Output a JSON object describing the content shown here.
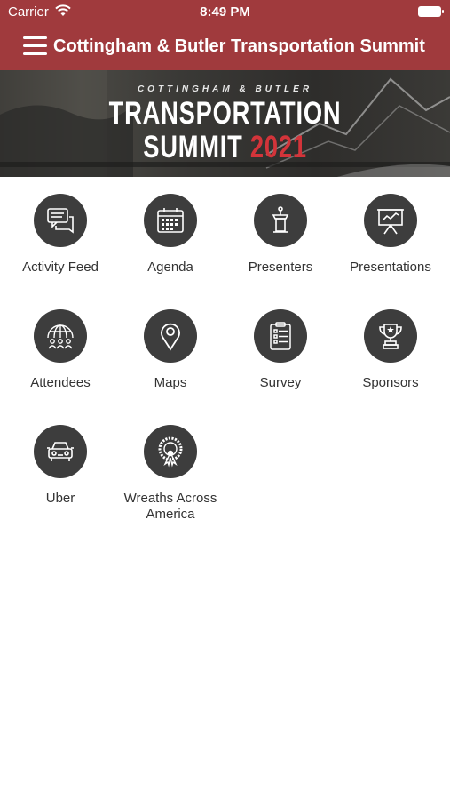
{
  "status_bar": {
    "carrier": "Carrier",
    "time": "8:49 PM"
  },
  "nav": {
    "title": "Cottingham & Butler Transportation Summit"
  },
  "banner": {
    "small": "COTTINGHAM & BUTLER",
    "line1": "TRANSPORTATION",
    "line2": "SUMMIT",
    "year": "2021"
  },
  "grid": {
    "activity_feed": "Activity Feed",
    "agenda": "Agenda",
    "presenters": "Presenters",
    "presentations": "Presentations",
    "attendees": "Attendees",
    "maps": "Maps",
    "survey": "Survey",
    "sponsors": "Sponsors",
    "uber": "Uber",
    "wreaths": "Wreaths Across America"
  },
  "colors": {
    "header": "#a03a3d",
    "icon_circle": "#3d3d3d",
    "accent_year": "#d3343a"
  }
}
